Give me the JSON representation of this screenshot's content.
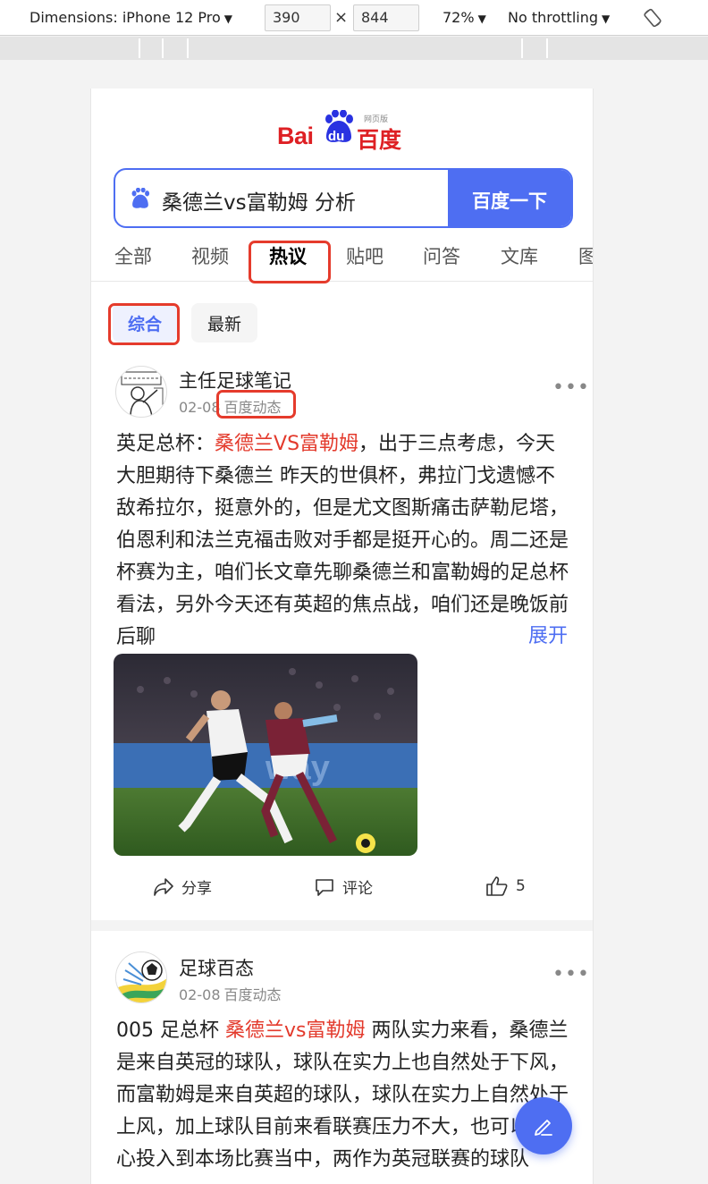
{
  "devtools": {
    "dimensions_label": "Dimensions: iPhone 12 Pro",
    "width": "390",
    "height": "844",
    "times": "×",
    "zoom": "72%",
    "throttling": "No throttling"
  },
  "logo": {
    "latin": "Bai",
    "du": "du",
    "chinese": "百度",
    "subtitle": "网页版"
  },
  "search": {
    "query": "桑德兰vs富勒姆 分析",
    "button": "百度一下"
  },
  "tabs": [
    {
      "label": "全部"
    },
    {
      "label": "视频"
    },
    {
      "label": "热议",
      "active": true
    },
    {
      "label": "贴吧"
    },
    {
      "label": "问答"
    },
    {
      "label": "文库"
    },
    {
      "label": "图"
    }
  ],
  "filters": {
    "selected": "综合",
    "other": "最新"
  },
  "posts": [
    {
      "author": "主任足球笔记",
      "date": "02-08",
      "source": "百度动态",
      "text_prefix": "英足总杯：",
      "text_highlight": "桑德兰VS富勒姆",
      "text_rest": "，出于三点考虑，今天大胆期待下桑德兰 昨天的世俱杯，弗拉门戈遗憾不敌希拉尔，挺意外的，但是尤文图斯痛击萨勒尼塔，伯恩利和法兰克福击败对手都是挺开心的。周二还是杯赛为主，咱们长文章先聊桑德兰和富勒姆的足总杯看法，另外今天还有英超的焦点战，咱们还是晚饭前后聊",
      "expand": "展开",
      "actions": {
        "share": "分享",
        "comment": "评论",
        "like_count": "5"
      }
    },
    {
      "author": "足球百态",
      "date": "02-08",
      "source": "百度动态",
      "text_prefix": "005 足总杯 ",
      "text_highlight": "桑德兰vs富勒姆",
      "text_rest": " 两队实力来看，桑德兰是来自英冠的球队，球队在实力上也自然处于下风，而富勒姆是来自英超的球队，球队在实力上自然处于上风，加上球队目前来看联赛压力不大，也可以全身心投入到本场比赛当中，两作为英冠联赛的球队"
    }
  ],
  "colors": {
    "accent": "#4e6ef2",
    "brand_red": "#de2024",
    "highlight": "#e33a2c",
    "annotation_box": "#e53b2c"
  }
}
